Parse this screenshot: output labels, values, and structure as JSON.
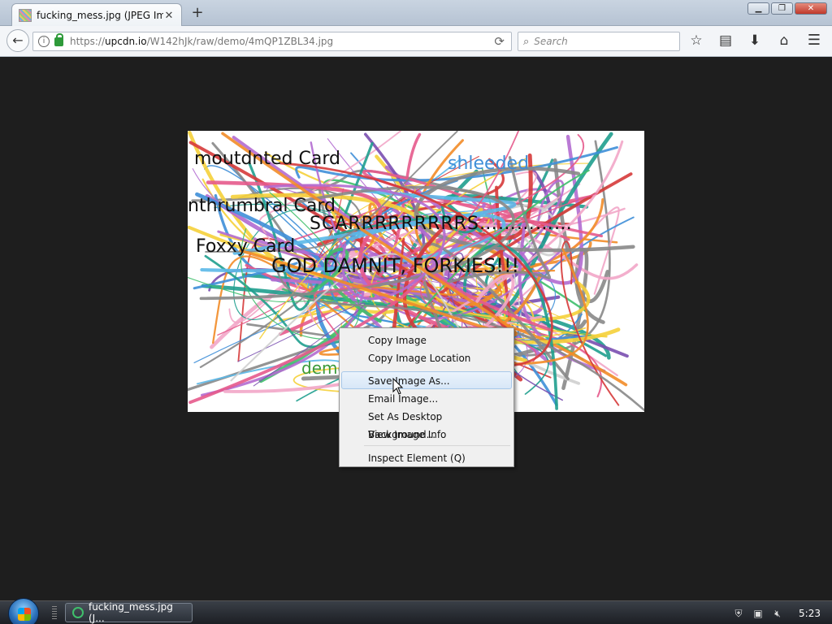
{
  "tab": {
    "title": "fucking_mess.jpg (JPEG Ima",
    "close_glyph": "✕",
    "new_tab_glyph": "+"
  },
  "window_controls": {
    "minimize": "▁",
    "maximize": "❐",
    "close": "✕"
  },
  "url_bar": {
    "prefix": "https://",
    "host": "upcdn.io",
    "path": "/W142hJk/raw/demo/4mQP1ZBL34.jpg"
  },
  "search_bar": {
    "placeholder": "Search"
  },
  "image_text": {
    "line1": "moutdnted Card",
    "line2": "nthrumbral Card",
    "line3": "SCARRRRRRRRRS……………",
    "line4": "Foxxy Card",
    "line5": "GOD DAMNIT, FORKIES!!!",
    "line6": "shleeded",
    "line7": "demented"
  },
  "context_menu": {
    "copy_image": "Copy Image",
    "copy_image_location": "Copy Image Location",
    "save_image_as": "Save Image As...",
    "email_image": "Email Image...",
    "set_desktop_background": "Set As Desktop Background...",
    "view_image_info": "View Image Info",
    "inspect_element": "Inspect Element (Q)"
  },
  "taskbar": {
    "task_label": "fucking_mess.jpg (J...",
    "clock": "5:23"
  },
  "colors": {
    "accent_green": "#2e9a3a",
    "menu_hover": "#d8e7f7",
    "background": "#1e1e1e"
  }
}
